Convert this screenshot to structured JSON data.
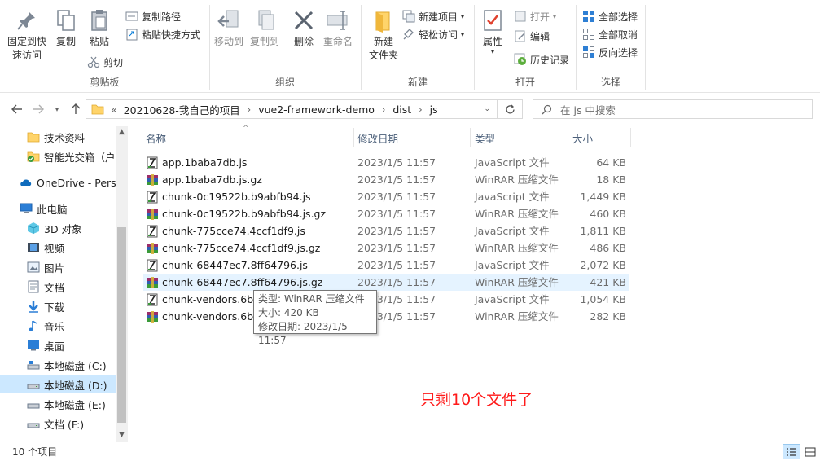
{
  "ribbon": {
    "clipboard": {
      "pin_label": "固定到快\n速访问",
      "copy_label": "复制",
      "paste_label": "粘贴",
      "copy_path_label": "复制路径",
      "paste_shortcut_label": "粘贴快捷方式",
      "cut_label": "剪切",
      "group_label": "剪贴板"
    },
    "organize": {
      "move_to_label": "移动到",
      "copy_to_label": "复制到",
      "delete_label": "删除",
      "rename_label": "重命名",
      "group_label": "组织"
    },
    "new": {
      "new_folder_label": "新建\n文件夹",
      "new_item_label": "新建项目",
      "easy_access_label": "轻松访问",
      "group_label": "新建"
    },
    "open": {
      "properties_label": "属性",
      "open_label": "打开",
      "edit_label": "编辑",
      "history_label": "历史记录",
      "group_label": "打开"
    },
    "select": {
      "select_all_label": "全部选择",
      "select_none_label": "全部取消",
      "invert_label": "反向选择",
      "group_label": "选择"
    }
  },
  "address": {
    "overflow": "«",
    "crumbs": [
      "20210628-我自己的项目",
      "vue2-framework-demo",
      "dist",
      "js"
    ],
    "search_placeholder": "在 js 中搜索"
  },
  "nav_pane": {
    "items": [
      {
        "label": "技术资料",
        "icon": "folder-icon"
      },
      {
        "label": "智能光交箱（户外",
        "icon": "folder-check-icon"
      },
      {
        "label": "OneDrive - Perso",
        "icon": "onedrive-icon"
      },
      {
        "label": "此电脑",
        "icon": "this-pc-icon"
      },
      {
        "label": "3D 对象",
        "icon": "3d-objects-icon"
      },
      {
        "label": "视频",
        "icon": "videos-icon"
      },
      {
        "label": "图片",
        "icon": "pictures-icon"
      },
      {
        "label": "文档",
        "icon": "documents-icon"
      },
      {
        "label": "下载",
        "icon": "downloads-icon"
      },
      {
        "label": "音乐",
        "icon": "music-icon"
      },
      {
        "label": "桌面",
        "icon": "desktop-icon"
      },
      {
        "label": "本地磁盘 (C:)",
        "icon": "drive-icon"
      },
      {
        "label": "本地磁盘 (D:)",
        "icon": "drive-icon"
      },
      {
        "label": "本地磁盘 (E:)",
        "icon": "drive-icon"
      },
      {
        "label": "文档 (F:)",
        "icon": "drive-icon"
      }
    ],
    "selected": "本地磁盘 (D:)"
  },
  "columns": {
    "name": "名称",
    "date": "修改日期",
    "type": "类型",
    "size": "大小"
  },
  "files": [
    {
      "name": "app.1baba7db.js",
      "date": "2023/1/5 11:57",
      "type": "JavaScript 文件",
      "size": "64 KB",
      "icon": "js-file-icon"
    },
    {
      "name": "app.1baba7db.js.gz",
      "date": "2023/1/5 11:57",
      "type": "WinRAR 压缩文件",
      "size": "18 KB",
      "icon": "winrar-icon"
    },
    {
      "name": "chunk-0c19522b.b9abfb94.js",
      "date": "2023/1/5 11:57",
      "type": "JavaScript 文件",
      "size": "1,449 KB",
      "icon": "js-file-icon"
    },
    {
      "name": "chunk-0c19522b.b9abfb94.js.gz",
      "date": "2023/1/5 11:57",
      "type": "WinRAR 压缩文件",
      "size": "460 KB",
      "icon": "winrar-icon"
    },
    {
      "name": "chunk-775cce74.4ccf1df9.js",
      "date": "2023/1/5 11:57",
      "type": "JavaScript 文件",
      "size": "1,811 KB",
      "icon": "js-file-icon"
    },
    {
      "name": "chunk-775cce74.4ccf1df9.js.gz",
      "date": "2023/1/5 11:57",
      "type": "WinRAR 压缩文件",
      "size": "486 KB",
      "icon": "winrar-icon"
    },
    {
      "name": "chunk-68447ec7.8ff64796.js",
      "date": "2023/1/5 11:57",
      "type": "JavaScript 文件",
      "size": "2,072 KB",
      "icon": "js-file-icon"
    },
    {
      "name": "chunk-68447ec7.8ff64796.js.gz",
      "date": "2023/1/5 11:57",
      "type": "WinRAR 压缩文件",
      "size": "421 KB",
      "icon": "winrar-icon"
    },
    {
      "name": "chunk-vendors.6b6",
      "date": "2023/1/5 11:57",
      "type": "JavaScript 文件",
      "size": "1,054 KB",
      "icon": "js-file-icon"
    },
    {
      "name": "chunk-vendors.6b6",
      "date": "2023/1/5 11:57",
      "type": "WinRAR 压缩文件",
      "size": "282 KB",
      "icon": "winrar-icon"
    }
  ],
  "tooltip": {
    "type_line": "类型: WinRAR 压缩文件",
    "size_line": "大小: 420 KB",
    "date_line": "修改日期: 2023/1/5 11:57"
  },
  "annotation": "只剩10个文件了",
  "status": {
    "item_count": "10 个项目"
  },
  "colors": {
    "accent": "#0078d7",
    "annotation": "#ff1a1a",
    "hover_row": "#e5f3ff",
    "selected_nav": "#cce8ff"
  }
}
